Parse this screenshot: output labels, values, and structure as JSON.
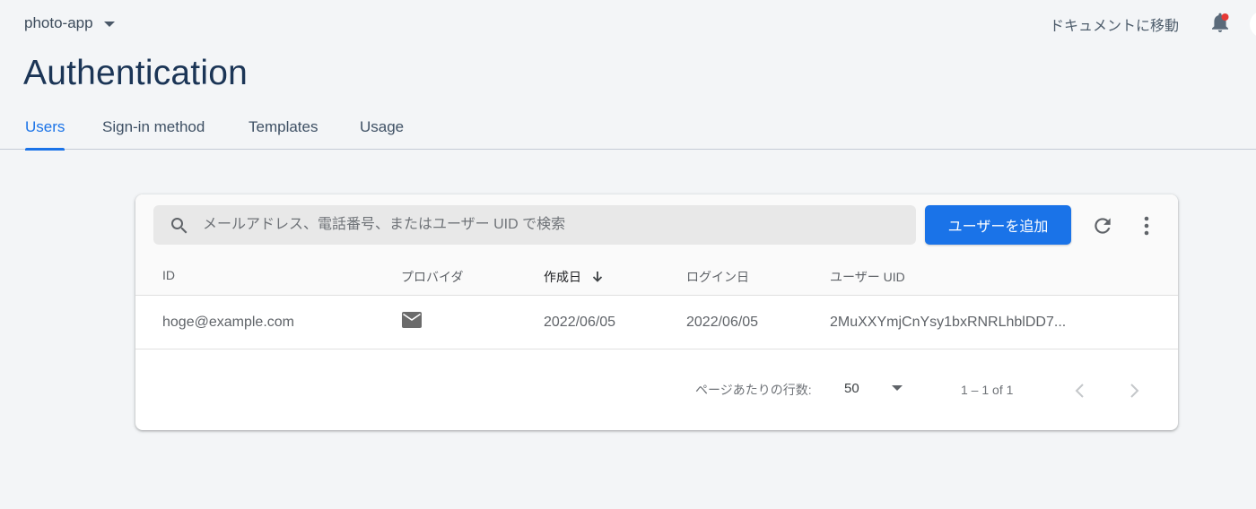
{
  "header": {
    "project_name": "photo-app",
    "docs_link": "ドキュメントに移動",
    "notification_dot_color": "#e53935"
  },
  "page": {
    "title": "Authentication"
  },
  "tabs": [
    {
      "label": "Users",
      "active": true
    },
    {
      "label": "Sign-in method",
      "active": false
    },
    {
      "label": "Templates",
      "active": false
    },
    {
      "label": "Usage",
      "active": false
    }
  ],
  "toolbar": {
    "search_placeholder": "メールアドレス、電話番号、またはユーザー UID で検索",
    "add_user_label": "ユーザーを追加",
    "refresh_icon": "refresh-icon",
    "more_icon": "more-vert-icon"
  },
  "table": {
    "columns": [
      "ID",
      "プロバイダ",
      "作成日",
      "ログイン日",
      "ユーザー UID"
    ],
    "sorted_column": "作成日",
    "sort_direction": "descending",
    "rows": [
      {
        "id": "hoge@example.com",
        "provider": "email-icon",
        "created": "2022/06/05",
        "signed_in": "2022/06/05",
        "uid": "2MuXXYmjCnYsy1bxRNRLhblDD7..."
      }
    ]
  },
  "pagination": {
    "rows_per_page_label": "ページあたりの行数:",
    "rows_per_page": "50",
    "range": "1 – 1 of 1"
  },
  "colors": {
    "accent": "#1a73e8",
    "title": "#1b3556",
    "background": "#f3f5f7"
  }
}
